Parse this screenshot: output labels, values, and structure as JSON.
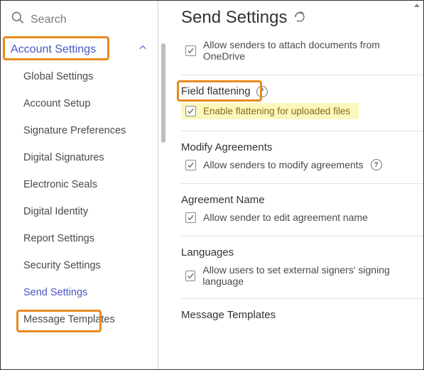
{
  "sidebar": {
    "search_placeholder": "Search",
    "group_label": "Account Settings",
    "items": [
      {
        "label": "Global Settings"
      },
      {
        "label": "Account Setup"
      },
      {
        "label": "Signature Preferences"
      },
      {
        "label": "Digital Signatures"
      },
      {
        "label": "Electronic Seals"
      },
      {
        "label": "Digital Identity"
      },
      {
        "label": "Report Settings"
      },
      {
        "label": "Security Settings"
      },
      {
        "label": "Send Settings"
      },
      {
        "label": "Message Templates"
      }
    ],
    "active_index": 8
  },
  "main": {
    "title": "Send Settings",
    "option_onedrive": "Allow senders to attach documents from OneDrive",
    "sections": {
      "field_flattening": {
        "title": "Field flattening",
        "option": "Enable flattening for uploaded files"
      },
      "modify_agreements": {
        "title": "Modify Agreements",
        "option": "Allow senders to modify agreements"
      },
      "agreement_name": {
        "title": "Agreement Name",
        "option": "Allow sender to edit agreement name"
      },
      "languages": {
        "title": "Languages",
        "option": "Allow users to set external signers' signing language"
      },
      "message_templates": {
        "title": "Message Templates"
      }
    }
  }
}
